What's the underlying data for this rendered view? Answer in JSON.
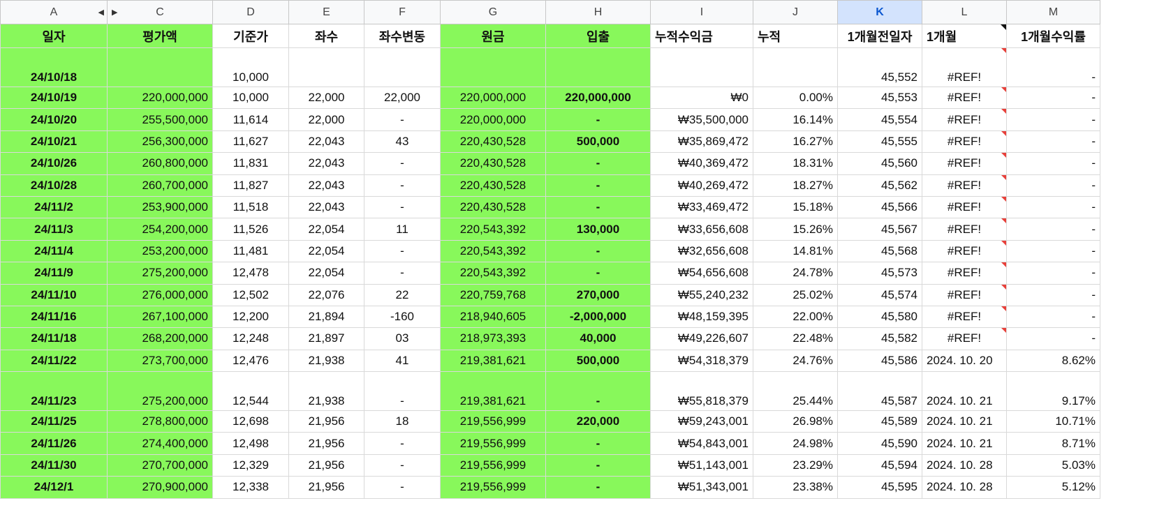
{
  "columns": [
    "A",
    "C",
    "D",
    "E",
    "F",
    "G",
    "H",
    "I",
    "J",
    "K",
    "L",
    "M"
  ],
  "active_column": "K",
  "headers": [
    "일자",
    "평가액",
    "기준가",
    "좌수",
    "좌수변동",
    "원금",
    "입출",
    "누적수익금",
    "누적",
    "1개월전일자",
    "1개월",
    "1개월수익률"
  ],
  "rows": [
    {
      "date": "24/10/18",
      "value": "",
      "nav": "10,000",
      "units": "",
      "change": "",
      "principal": "",
      "flow": "",
      "cum_profit": "",
      "cum_pct": "",
      "prev_date": "45,552",
      "month": "#REF!",
      "month_ret": "-"
    },
    {
      "date": "24/10/19",
      "value": "220,000,000",
      "nav": "10,000",
      "units": "22,000",
      "change": "22,000",
      "principal": "220,000,000",
      "flow": "220,000,000",
      "cum_profit": "₩0",
      "cum_pct": "0.00%",
      "prev_date": "45,553",
      "month": "#REF!",
      "month_ret": "-"
    },
    {
      "date": "24/10/20",
      "value": "255,500,000",
      "nav": "11,614",
      "units": "22,000",
      "change": "-",
      "principal": "220,000,000",
      "flow": "-",
      "cum_profit": "₩35,500,000",
      "cum_pct": "16.14%",
      "prev_date": "45,554",
      "month": "#REF!",
      "month_ret": "-"
    },
    {
      "date": "24/10/21",
      "value": "256,300,000",
      "nav": "11,627",
      "units": "22,043",
      "change": "43",
      "principal": "220,430,528",
      "flow": "500,000",
      "cum_profit": "₩35,869,472",
      "cum_pct": "16.27%",
      "prev_date": "45,555",
      "month": "#REF!",
      "month_ret": "-"
    },
    {
      "date": "24/10/26",
      "value": "260,800,000",
      "nav": "11,831",
      "units": "22,043",
      "change": "-",
      "principal": "220,430,528",
      "flow": "-",
      "cum_profit": "₩40,369,472",
      "cum_pct": "18.31%",
      "prev_date": "45,560",
      "month": "#REF!",
      "month_ret": "-"
    },
    {
      "date": "24/10/28",
      "value": "260,700,000",
      "nav": "11,827",
      "units": "22,043",
      "change": "-",
      "principal": "220,430,528",
      "flow": "-",
      "cum_profit": "₩40,269,472",
      "cum_pct": "18.27%",
      "prev_date": "45,562",
      "month": "#REF!",
      "month_ret": "-"
    },
    {
      "date": "24/11/2",
      "value": "253,900,000",
      "nav": "11,518",
      "units": "22,043",
      "change": "-",
      "principal": "220,430,528",
      "flow": "-",
      "cum_profit": "₩33,469,472",
      "cum_pct": "15.18%",
      "prev_date": "45,566",
      "month": "#REF!",
      "month_ret": "-"
    },
    {
      "date": "24/11/3",
      "value": "254,200,000",
      "nav": "11,526",
      "units": "22,054",
      "change": "11",
      "principal": "220,543,392",
      "flow": "130,000",
      "cum_profit": "₩33,656,608",
      "cum_pct": "15.26%",
      "prev_date": "45,567",
      "month": "#REF!",
      "month_ret": "-"
    },
    {
      "date": "24/11/4",
      "value": "253,200,000",
      "nav": "11,481",
      "units": "22,054",
      "change": "-",
      "principal": "220,543,392",
      "flow": "-",
      "cum_profit": "₩32,656,608",
      "cum_pct": "14.81%",
      "prev_date": "45,568",
      "month": "#REF!",
      "month_ret": "-"
    },
    {
      "date": "24/11/9",
      "value": "275,200,000",
      "nav": "12,478",
      "units": "22,054",
      "change": "-",
      "principal": "220,543,392",
      "flow": "-",
      "cum_profit": "₩54,656,608",
      "cum_pct": "24.78%",
      "prev_date": "45,573",
      "month": "#REF!",
      "month_ret": "-"
    },
    {
      "date": "24/11/10",
      "value": "276,000,000",
      "nav": "12,502",
      "units": "22,076",
      "change": "22",
      "principal": "220,759,768",
      "flow": "270,000",
      "cum_profit": "₩55,240,232",
      "cum_pct": "25.02%",
      "prev_date": "45,574",
      "month": "#REF!",
      "month_ret": "-"
    },
    {
      "date": "24/11/16",
      "value": "267,100,000",
      "nav": "12,200",
      "units": "21,894",
      "change": "-160",
      "principal": "218,940,605",
      "flow": "-2,000,000",
      "cum_profit": "₩48,159,395",
      "cum_pct": "22.00%",
      "prev_date": "45,580",
      "month": "#REF!",
      "month_ret": "-"
    },
    {
      "date": "24/11/18",
      "value": "268,200,000",
      "nav": "12,248",
      "units": "21,897",
      "change": "03",
      "principal": "218,973,393",
      "flow": "40,000",
      "cum_profit": "₩49,226,607",
      "cum_pct": "22.48%",
      "prev_date": "45,582",
      "month": "#REF!",
      "month_ret": "-"
    },
    {
      "date": "24/11/22",
      "value": "273,700,000",
      "nav": "12,476",
      "units": "21,938",
      "change": "41",
      "principal": "219,381,621",
      "flow": "500,000",
      "cum_profit": "₩54,318,379",
      "cum_pct": "24.76%",
      "prev_date": "45,586",
      "month": "2024. 10. 20",
      "month_ret": "8.62%"
    },
    {
      "date": "24/11/23",
      "value": "275,200,000",
      "nav": "12,544",
      "units": "21,938",
      "change": "-",
      "principal": "219,381,621",
      "flow": "-",
      "cum_profit": "₩55,818,379",
      "cum_pct": "25.44%",
      "prev_date": "45,587",
      "month": "2024. 10. 21",
      "month_ret": "9.17%"
    },
    {
      "date": "24/11/25",
      "value": "278,800,000",
      "nav": "12,698",
      "units": "21,956",
      "change": "18",
      "principal": "219,556,999",
      "flow": "220,000",
      "cum_profit": "₩59,243,001",
      "cum_pct": "26.98%",
      "prev_date": "45,589",
      "month": "2024. 10. 21",
      "month_ret": "10.71%"
    },
    {
      "date": "24/11/26",
      "value": "274,400,000",
      "nav": "12,498",
      "units": "21,956",
      "change": "-",
      "principal": "219,556,999",
      "flow": "-",
      "cum_profit": "₩54,843,001",
      "cum_pct": "24.98%",
      "prev_date": "45,590",
      "month": "2024. 10. 21",
      "month_ret": "8.71%"
    },
    {
      "date": "24/11/30",
      "value": "270,700,000",
      "nav": "12,329",
      "units": "21,956",
      "change": "-",
      "principal": "219,556,999",
      "flow": "-",
      "cum_profit": "₩51,143,001",
      "cum_pct": "23.29%",
      "prev_date": "45,594",
      "month": "2024. 10. 28",
      "month_ret": "5.03%"
    },
    {
      "date": "24/12/1",
      "value": "270,900,000",
      "nav": "12,338",
      "units": "21,956",
      "change": "-",
      "principal": "219,556,999",
      "flow": "-",
      "cum_profit": "₩51,343,001",
      "cum_pct": "23.38%",
      "prev_date": "45,595",
      "month": "2024. 10. 28",
      "month_ret": "5.12%"
    }
  ],
  "colors": {
    "green_fill": "#88f85b",
    "active_header": "#d3e3fd",
    "note_marker": "#e8403a"
  },
  "icons": {
    "hidden_columns_left": "triangle-left-icon",
    "hidden_columns_right": "triangle-right-icon"
  }
}
